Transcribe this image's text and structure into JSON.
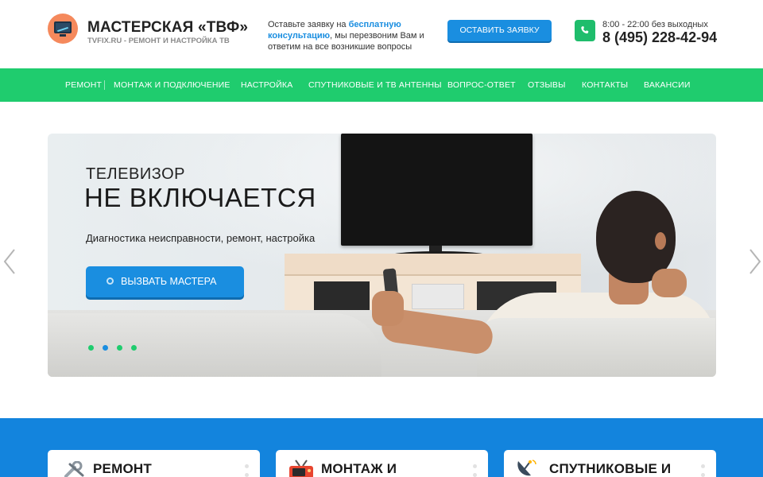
{
  "header": {
    "brand_name": "МАСТЕРСКАЯ «ТВФ»",
    "brand_sub": "TVFIX.RU - РЕМОНТ И НАСТРОЙКА ТВ",
    "callback_pre": "Оставьте заявку на ",
    "callback_link": "бесплатную консультацию",
    "callback_post": ", мы перезвоним Вам и ответим на все возникшие вопросы",
    "cta_label": "ОСТАВИТЬ ЗАЯВКУ",
    "hours": "8:00 - 22:00 без выходных",
    "phone": "8 (495) 228-42-94"
  },
  "nav": {
    "items": [
      {
        "label": "РЕМОНТ"
      },
      {
        "label": "МОНТАЖ И ПОДКЛЮЧЕНИЕ"
      },
      {
        "label": "НАСТРОЙКА"
      },
      {
        "label": "СПУТНИКОВЫЕ И ТВ АНТЕННЫ"
      },
      {
        "label": "ВОПРОС-ОТВЕТ"
      },
      {
        "label": "ОТЗЫВЫ"
      },
      {
        "label": "КОНТАКТЫ"
      },
      {
        "label": "ВАКАНСИИ"
      }
    ]
  },
  "hero": {
    "eyebrow": "ТЕЛЕВИЗОР",
    "title": "НЕ ВКЛЮЧАЕТСЯ",
    "subtitle": "Диагностика неисправности, ремонт, настройка",
    "button_label": "ВЫЗВАТЬ МАСТЕРА",
    "slide_count": 4,
    "active_slide": 2
  },
  "services": {
    "cards": [
      {
        "title": "РЕМОНТ",
        "icon": "tools-icon"
      },
      {
        "title": "МОНТАЖ И",
        "icon": "tv-icon"
      },
      {
        "title": "СПУТНИКОВЫЕ И",
        "icon": "satellite-dish-icon"
      }
    ]
  },
  "colors": {
    "nav_green": "#1fcc6e",
    "accent_blue": "#1a8ee0",
    "services_blue": "#1384dd",
    "logo_orange": "#f5895c",
    "phone_green": "#1fbd6c"
  }
}
